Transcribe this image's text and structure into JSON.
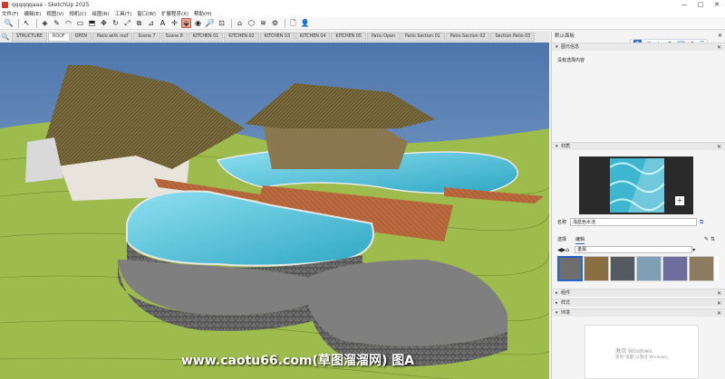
{
  "window": {
    "title": "qqqqqqaaa - SketchUp 2025",
    "controls": [
      "—",
      "□",
      "✕"
    ]
  },
  "menu": [
    "文件(F)",
    "编辑(E)",
    "视图(V)",
    "相机(C)",
    "绘图(R)",
    "工具(T)",
    "窗口(W)",
    "扩展程序(X)",
    "帮助(H)"
  ],
  "toolbar": {
    "buttons": [
      {
        "icon": "search-icon",
        "glyph": "🔍"
      },
      {
        "icon": "select-icon",
        "glyph": "↖"
      },
      {
        "icon": "eraser-icon",
        "glyph": "◈"
      },
      {
        "icon": "pencil-icon",
        "glyph": "✎"
      },
      {
        "icon": "arc-icon",
        "glyph": "◠"
      },
      {
        "icon": "rectangle-icon",
        "glyph": "▭"
      },
      {
        "icon": "pushpull-icon",
        "glyph": "⬒"
      },
      {
        "icon": "move-icon",
        "glyph": "✥"
      },
      {
        "icon": "rotate-icon",
        "glyph": "↻"
      },
      {
        "icon": "scale-icon",
        "glyph": "⤢"
      },
      {
        "icon": "offset-icon",
        "glyph": "⧉"
      },
      {
        "icon": "tape-icon",
        "glyph": "⊿"
      },
      {
        "icon": "text-icon",
        "glyph": "A"
      },
      {
        "icon": "axes-icon",
        "glyph": "✛"
      },
      {
        "icon": "paint-icon",
        "glyph": "⬙"
      },
      {
        "icon": "orbit-icon",
        "glyph": "◉"
      },
      {
        "icon": "zoom-icon",
        "glyph": "🔎"
      },
      {
        "icon": "zoom-extents-icon",
        "glyph": "⊡"
      },
      {
        "icon": "warehouse-icon",
        "glyph": "⌂"
      },
      {
        "icon": "extension-icon",
        "glyph": "⬡"
      },
      {
        "icon": "layer-icon",
        "glyph": "≋"
      },
      {
        "icon": "settings-icon",
        "glyph": "⚙"
      },
      {
        "icon": "new-icon",
        "glyph": "🗋"
      },
      {
        "icon": "profile-icon",
        "glyph": "👤"
      }
    ]
  },
  "scenes": {
    "tabs": [
      "STRUCTURE",
      "ROOF",
      "OPEN",
      "Patio with roof",
      "Scene 7",
      "Scene 8",
      "KITCHEN 01",
      "KITCHEN 02",
      "KITCHEN 03",
      "KITCHEN 04",
      "KITCHEN 05",
      "Patio Open",
      "Patio Section 01",
      "Patio Section 02",
      "Section Patio 03"
    ],
    "active_index": 1
  },
  "panel": {
    "title": "默认面板",
    "entity_info": {
      "header": "图元信息",
      "text": "没有选择内容"
    },
    "materials": {
      "header": "材质",
      "name_label": "名称",
      "name_value": "浅蓝色水池",
      "tab_select": "选择",
      "tab_edit": "编辑",
      "library": "金属",
      "swatch_colors": [
        "#6e6e6e",
        "#8a6f45",
        "#555a60",
        "#7f9fb5",
        "#6d6d9e",
        "#8d7b60"
      ]
    },
    "components_header": "组件",
    "styles_header": "样式",
    "environment_header": "环境",
    "watermark_line1": "激活 Windows",
    "watermark_line2": "转到\"设置\"以激活 Windows。"
  },
  "caption": "www.caotu66.com(草图溜溜网) 图A"
}
